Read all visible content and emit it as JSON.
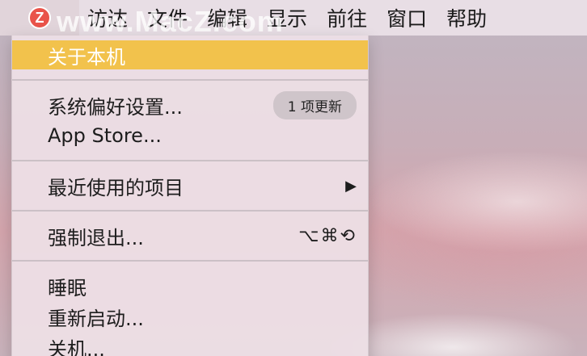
{
  "menubar": {
    "logo_letter": "Z",
    "items": [
      "访达",
      "文件",
      "编辑",
      "显示",
      "前往",
      "窗口",
      "帮助"
    ]
  },
  "watermark": "www.MacZ.com",
  "menu": {
    "about": "关于本机",
    "preferences": "系统偏好设置...",
    "preferences_badge": "1 项更新",
    "app_store": "App Store...",
    "recent_items": "最近使用的项目",
    "recent_arrow": "▶",
    "force_quit": "强制退出...",
    "force_quit_shortcut": "⌥⌘⟲",
    "sleep": "睡眠",
    "restart": "重新启动...",
    "shutdown": "关机..."
  },
  "colors": {
    "highlight": "#f2c24c",
    "logo": "#e9534a"
  }
}
